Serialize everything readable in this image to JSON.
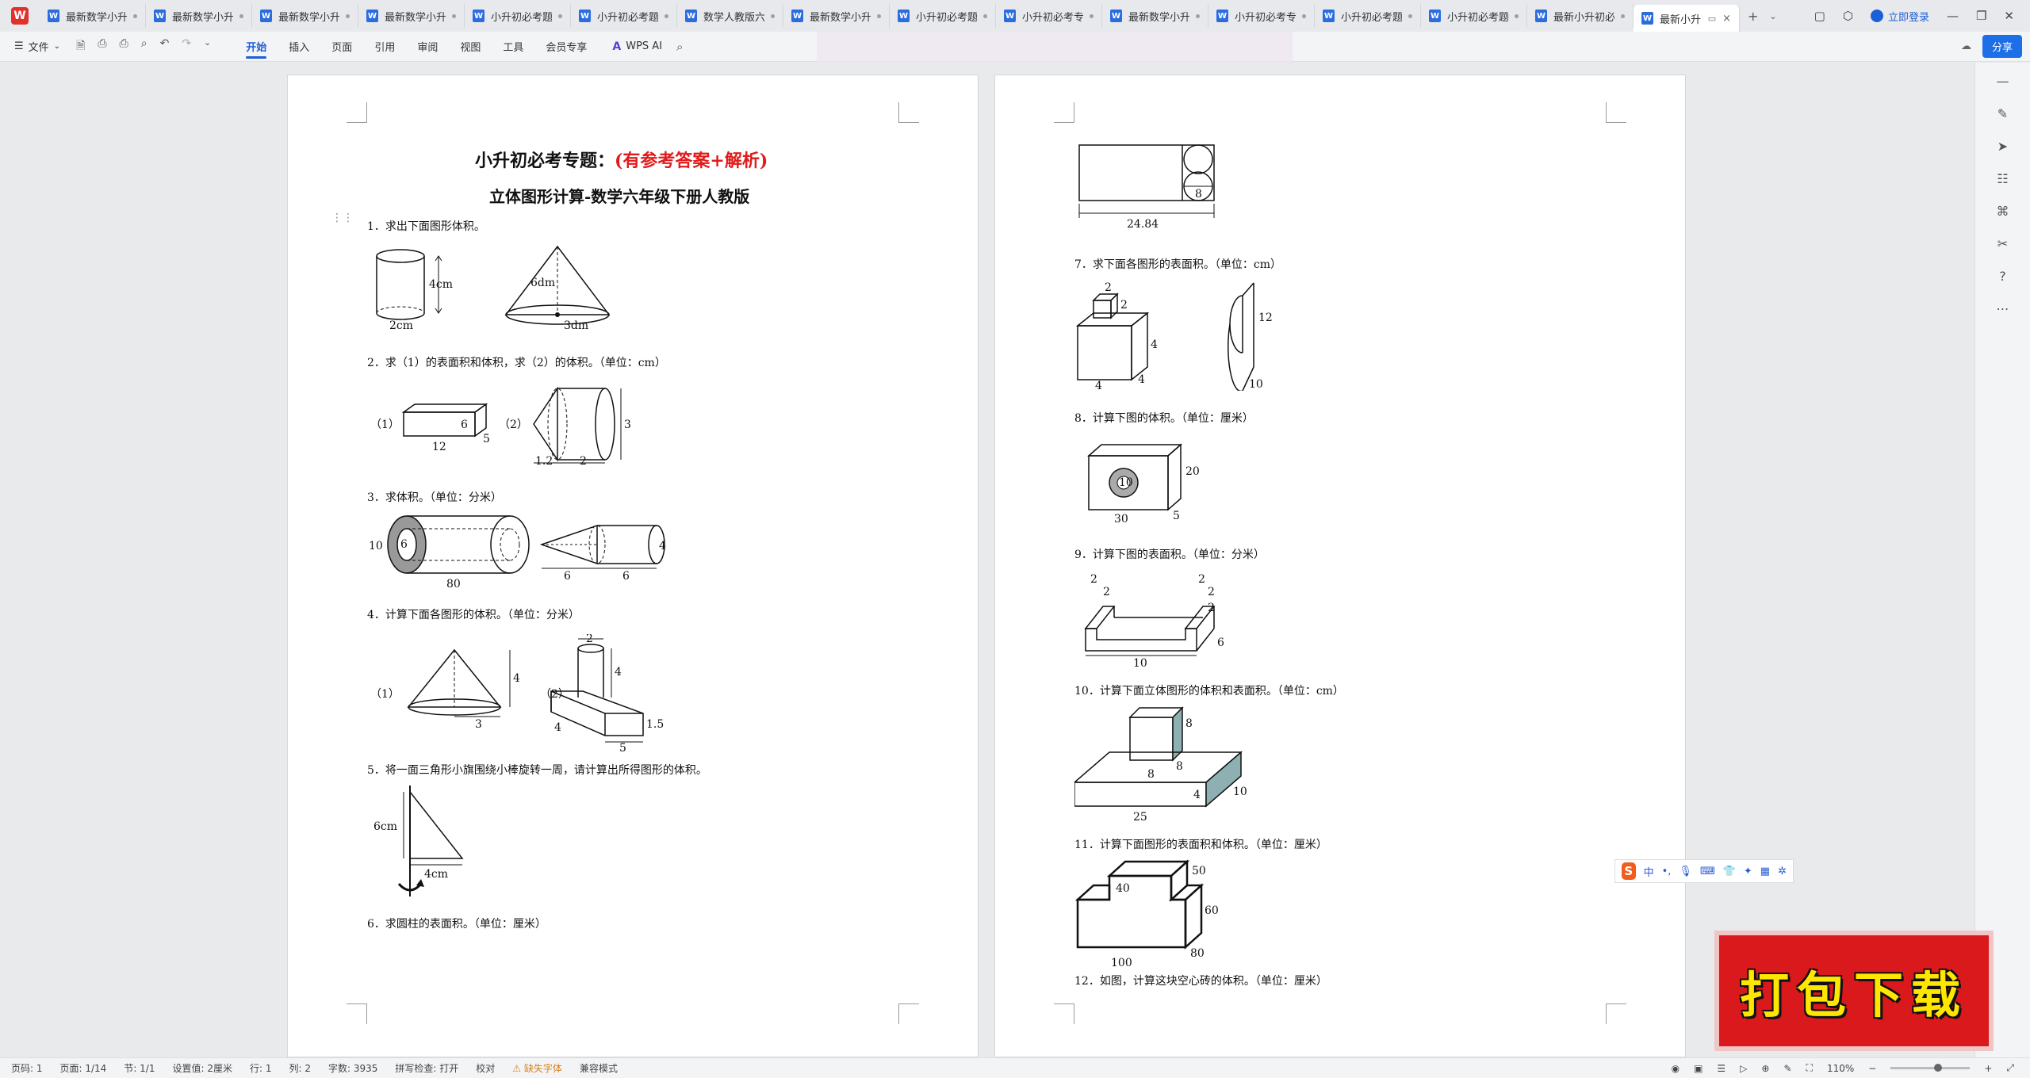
{
  "tabs": [
    {
      "label": "最新数学小升"
    },
    {
      "label": "最新数学小升初"
    },
    {
      "label": "最新数学小升"
    },
    {
      "label": "最新数学小升"
    },
    {
      "label": "小升初必考题型"
    },
    {
      "label": "小升初必考题型"
    },
    {
      "label": "数学人教版六年"
    },
    {
      "label": "最新数学小升"
    },
    {
      "label": "小升初必考题型"
    },
    {
      "label": "小升初必考专题"
    },
    {
      "label": "最新数学小升"
    },
    {
      "label": "小升初必考专题"
    },
    {
      "label": "小升初必考题型"
    },
    {
      "label": "小升初必考题型"
    },
    {
      "label": "最新小升初必"
    }
  ],
  "active_tab": {
    "label": "最新小升"
  },
  "login_label": "立即登录",
  "ribbon": {
    "file_label": "文件",
    "menu": [
      "开始",
      "插入",
      "页面",
      "引用",
      "审阅",
      "视图",
      "工具",
      "会员专享"
    ],
    "active_menu": "开始",
    "wps_ai": "WPS AI",
    "share": "分享"
  },
  "page1": {
    "title_black": "小升初必考专题：",
    "title_red": "(有参考答案+解析)",
    "subtitle": "立体图形计算-数学六年级下册人教版",
    "q1": "1．求出下面图形体积。",
    "q2": "2．求（1）的表面积和体积，求（2）的体积。（单位：cm）",
    "q3": "3．求体积。（单位：分米）",
    "q4": "4．计算下面各图形的体积。（单位：分米）",
    "q5": "5．将一面三角形小旗围绕小棒旋转一周，请计算出所得图形的体积。",
    "q6": "6．求圆柱的表面积。（单位：厘米）",
    "fig1": {
      "h": "4cm",
      "d": "2cm",
      "cone_h": "6dm",
      "cone_r": "3dm"
    },
    "fig2": {
      "p1": "（1）",
      "p2": "（2）",
      "l": "12",
      "w": "5",
      "h": "6",
      "a": "1.2",
      "b": "2",
      "c": "3"
    },
    "fig3": {
      "d1": "10",
      "d2": "6",
      "len": "80",
      "r": "4",
      "a": "6",
      "b": "6"
    },
    "fig4": {
      "p1": "（1）",
      "p2": "（2）",
      "cone_h": "4",
      "cone_r": "3",
      "top": "2",
      "h1": "4",
      "base_a": "4",
      "base_b": "5",
      "base_h": "1.5"
    },
    "fig5": {
      "h": "6cm",
      "b": "4cm"
    }
  },
  "page2": {
    "fig6": {
      "len": "24.84",
      "d": "8"
    },
    "q7": "7．求下面各图形的表面积。（单位：cm）",
    "fig7": {
      "s1": "2",
      "s2": "2",
      "s3": "4",
      "s4": "4",
      "s5": "4",
      "h": "12",
      "d": "10"
    },
    "q8": "8．计算下图的体积。（单位：厘米）",
    "fig8": {
      "d": "10",
      "l": "30",
      "w": "5",
      "h": "20"
    },
    "q9": "9．计算下图的表面积。（单位：分米）",
    "fig9": {
      "a": "2",
      "b": "2",
      "c": "2",
      "d": "2",
      "e": "2",
      "f": "6",
      "l": "10"
    },
    "q10": "10．计算下面立体图形的体积和表面积。（单位：cm）",
    "fig10": {
      "c1": "8",
      "c2": "8",
      "c3": "8",
      "h": "4",
      "w": "10",
      "l": "25"
    },
    "q11": "11．计算下面图形的表面积和体积。（单位：厘米）",
    "fig11": {
      "a": "40",
      "b": "50",
      "c": "60",
      "d": "80",
      "e": "100"
    },
    "q12": "12．如图，计算这块空心砖的体积。（单位：厘米）"
  },
  "banner": "打包下载",
  "ime_label": "中",
  "statusbar": {
    "page": "页码: 1",
    "pages": "页面: 1/14",
    "section": "节: 1/1",
    "setting": "设置值: 2厘米",
    "row": "行: 1",
    "col": "列: 2",
    "words": "字数: 3935",
    "spell": "拼写检查: 打开",
    "proof": "校对",
    "missing_font": "缺失字体",
    "compat": "兼容模式",
    "zoom": "110%"
  }
}
